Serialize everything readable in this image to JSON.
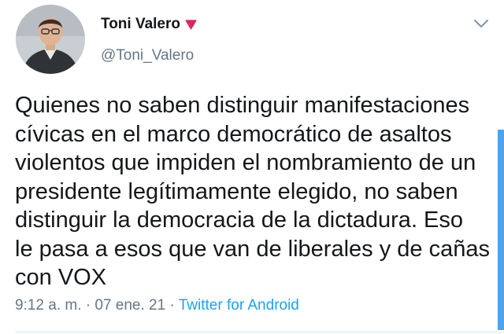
{
  "author": {
    "display_name": "Toni Valero",
    "handle": "@Toni_Valero"
  },
  "tweet": {
    "lines": [
      "Quienes no saben distinguir manifestaciones",
      "cívicas en el marco democrático de asaltos",
      "violentos que impiden el nombramiento de un",
      "presidente legítimamente elegido, no saben",
      "distinguir la democracia de la dictadura. Eso",
      "le pasa a esos que van de liberales y de cañas",
      "con VOX"
    ],
    "time": "9:12 a. m.",
    "separator": "·",
    "date": "07 ene. 21",
    "source": "Twitter for Android"
  },
  "icons": {
    "badge": "red-down-triangle-icon",
    "menu": "chevron-down-icon"
  },
  "colors": {
    "name": "#14171a",
    "secondary": "#657786",
    "link": "#1da1f2",
    "badge": "#e0245e",
    "scrollbar": "#4aa3f0"
  }
}
